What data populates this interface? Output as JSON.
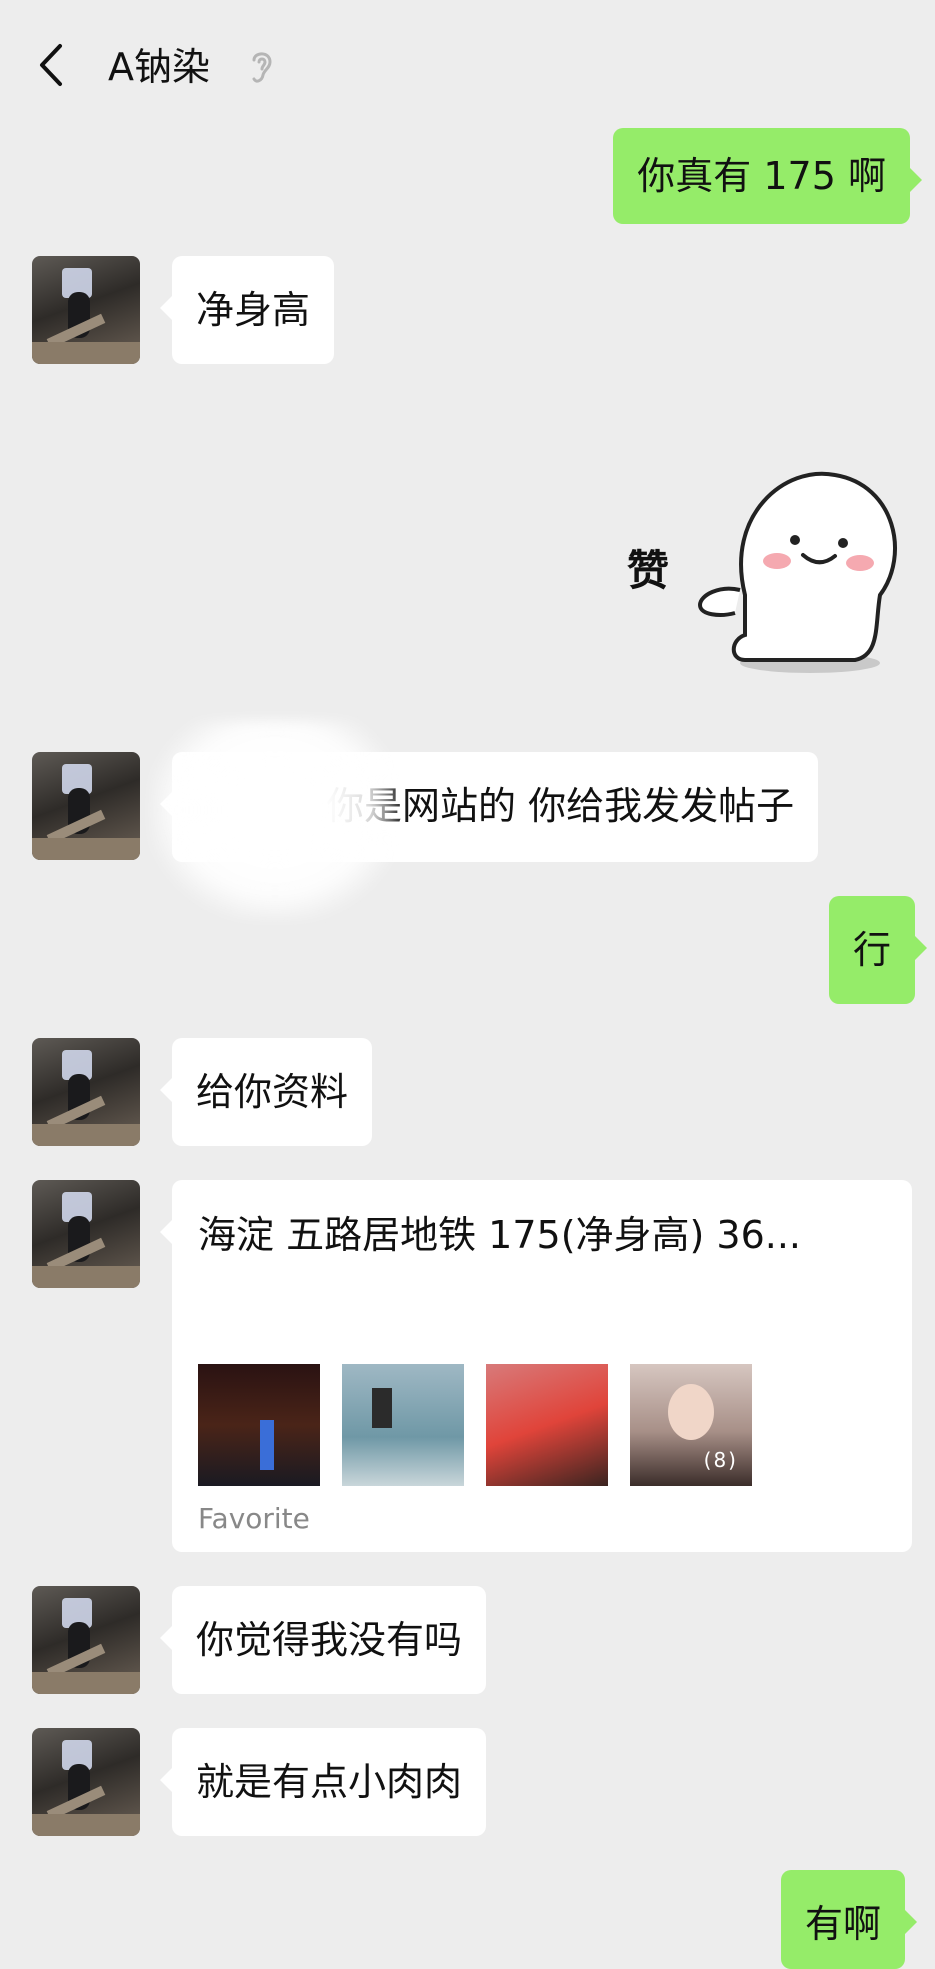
{
  "header": {
    "title": "A钠染"
  },
  "messages": {
    "m1": "你真有 175 啊",
    "m2": "净身高",
    "m4": "你是网站的  你给我发发帖子",
    "m5": "行",
    "m6": "给你资料",
    "m8": "你觉得我没有吗",
    "m9": "就是有点小肉肉",
    "m10": "有啊"
  },
  "sticker": {
    "text": "赞"
  },
  "link_card": {
    "title": "海淀 五路居地铁 175(净身高) 36...",
    "footer": "Favorite",
    "image_count": "(8)"
  },
  "colors": {
    "background": "#ededed",
    "outgoing_bubble": "#95ec69",
    "incoming_bubble": "#ffffff",
    "footer_text": "#888888"
  },
  "icons": [
    "back-chevron-icon",
    "ear-icon",
    "avatar-image",
    "sticker-image"
  ]
}
